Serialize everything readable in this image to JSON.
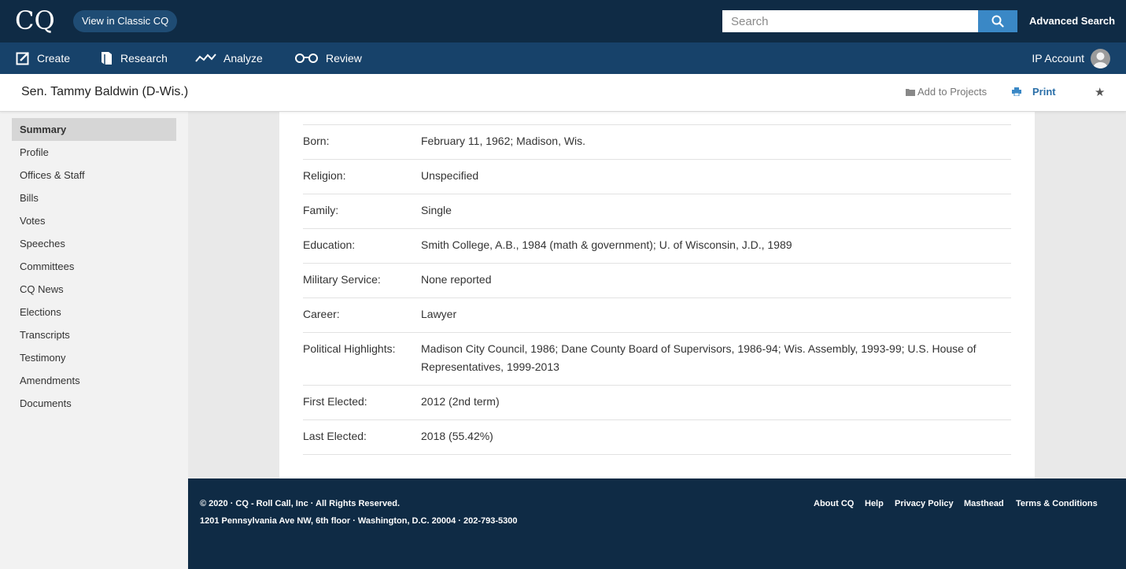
{
  "header": {
    "logo_text": "CQ",
    "classic_label": "View in Classic CQ",
    "search_placeholder": "Search",
    "advanced_search": "Advanced Search"
  },
  "nav": {
    "items": [
      {
        "label": "Create",
        "icon": "edit-icon"
      },
      {
        "label": "Research",
        "icon": "book-icon"
      },
      {
        "label": "Analyze",
        "icon": "line-chart-icon"
      },
      {
        "label": "Review",
        "icon": "glasses-icon"
      }
    ],
    "account_label": "IP Account"
  },
  "titlebar": {
    "title": "Sen. Tammy Baldwin (D-Wis.)",
    "add_to_projects": "Add to Projects",
    "print": "Print"
  },
  "sidebar": {
    "items": [
      {
        "label": "Summary",
        "active": true
      },
      {
        "label": "Profile"
      },
      {
        "label": "Offices & Staff"
      },
      {
        "label": "Bills"
      },
      {
        "label": "Votes"
      },
      {
        "label": "Speeches"
      },
      {
        "label": "Committees"
      },
      {
        "label": "CQ News"
      },
      {
        "label": "Elections"
      },
      {
        "label": "Transcripts"
      },
      {
        "label": "Testimony"
      },
      {
        "label": "Amendments"
      },
      {
        "label": "Documents"
      }
    ]
  },
  "profile": {
    "rows": [
      {
        "label": "Born:",
        "value": "February 11, 1962; Madison, Wis."
      },
      {
        "label": "Religion:",
        "value": "Unspecified"
      },
      {
        "label": "Family:",
        "value": "Single"
      },
      {
        "label": "Education:",
        "value": "Smith College, A.B., 1984 (math & government); U. of Wisconsin, J.D., 1989"
      },
      {
        "label": "Military Service:",
        "value": "None reported"
      },
      {
        "label": "Career:",
        "value": "Lawyer"
      },
      {
        "label": "Political Highlights:",
        "value": "Madison City Council, 1986; Dane County Board of Supervisors, 1986-94; Wis. Assembly, 1993-99; U.S. House of Representatives, 1999-2013"
      },
      {
        "label": "First Elected:",
        "value": "2012 (2nd term)"
      },
      {
        "label": "Last Elected:",
        "value": "2018 (55.42%)"
      }
    ]
  },
  "footer": {
    "copyright": "© 2020 · CQ - Roll Call, Inc · All Rights Reserved.",
    "address": "1201 Pennsylvania Ave NW, 6th floor · Washington, D.C. 20004 · 202-793-5300",
    "links": [
      "About CQ",
      "Help",
      "Privacy Policy",
      "Masthead",
      "Terms & Conditions"
    ]
  },
  "colors": {
    "topbar": "#0f2b45",
    "navbar": "#17426a",
    "accent": "#3a88c6",
    "link": "#2a6fa8"
  }
}
